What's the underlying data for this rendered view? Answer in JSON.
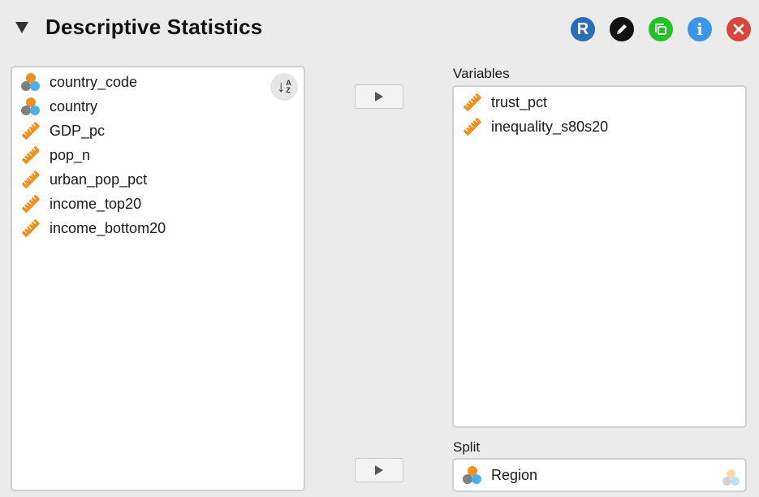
{
  "header": {
    "title": "Descriptive Statistics",
    "r_button_label": "R",
    "info_button_label": "i",
    "buttons": [
      "r-syntax-icon",
      "edit-icon",
      "copy-icon",
      "info-icon",
      "close-icon"
    ]
  },
  "source_list": {
    "items": [
      {
        "label": "country_code",
        "type": "nominal"
      },
      {
        "label": "country",
        "type": "nominal"
      },
      {
        "label": "GDP_pc",
        "type": "scale"
      },
      {
        "label": "pop_n",
        "type": "scale"
      },
      {
        "label": "urban_pop_pct",
        "type": "scale"
      },
      {
        "label": "income_top20",
        "type": "scale"
      },
      {
        "label": "income_bottom20",
        "type": "scale"
      }
    ],
    "sort_arrow": "↓",
    "sort_a": "A",
    "sort_z": "Z"
  },
  "variables": {
    "label": "Variables",
    "items": [
      {
        "label": "trust_pct",
        "type": "scale"
      },
      {
        "label": "inequality_s80s20",
        "type": "scale"
      }
    ]
  },
  "split": {
    "label": "Split",
    "items": [
      {
        "label": "Region",
        "type": "nominal"
      }
    ]
  },
  "colors": {
    "accent_orange": "#f28e1c",
    "accent_blue": "#4ab2e8",
    "accent_grey": "#7f7f7f",
    "r_button": "#2a6ebb",
    "copy_button": "#1fc420",
    "info_button": "#3a96e6",
    "close_button": "#d9453c"
  }
}
